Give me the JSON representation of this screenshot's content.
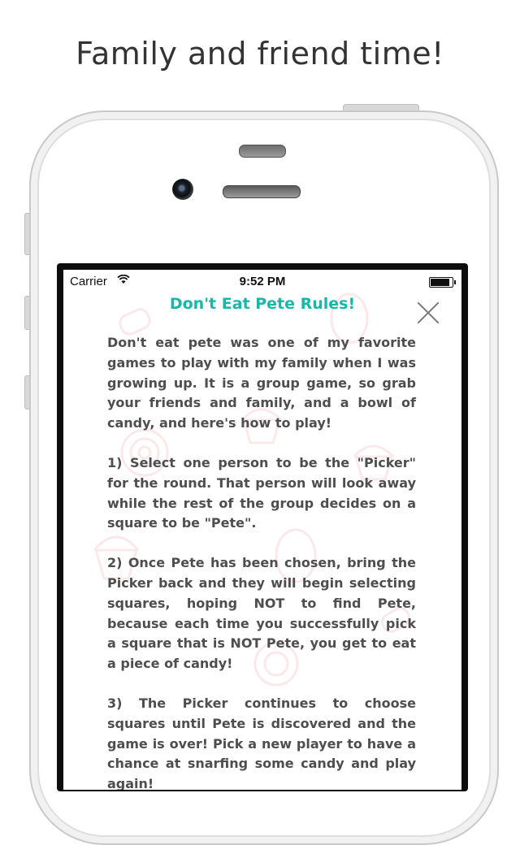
{
  "caption": "Family and friend time!",
  "status_bar": {
    "carrier": "Carrier",
    "time": "9:52 PM",
    "battery_level": 0.9
  },
  "screen": {
    "title": "Don't Eat Pete Rules!",
    "close_icon": "close-icon",
    "paragraphs": [
      "Don't eat pete was one of my favorite games to play with my family when I was growing up. It is a group game, so grab your friends and family, and a bowl of candy, and here's how to play!",
      "1) Select one person to be the \"Picker\" for the round. That person will look away while the rest of the group decides on a square to be \"Pete\".",
      "2) Once Pete has been chosen, bring the Picker back and they will begin selecting squares, hoping NOT to find Pete, because each time you successfully pick a square that is NOT Pete, you get to eat a piece of candy!",
      "3) The Picker continues to choose squares until Pete is discovered and the game is over! Pick a new player to have a chance at snarfing some candy and play again!"
    ]
  },
  "colors": {
    "accent": "#17b8a6",
    "text": "#4e4e4e",
    "candy_pattern": "#e34d5a"
  }
}
